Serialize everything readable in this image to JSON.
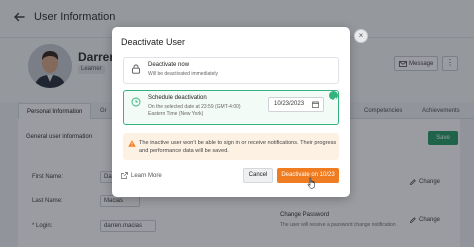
{
  "page": {
    "title": "User Information",
    "user_name": "Darren",
    "role": "Learner",
    "message_label": "Message",
    "more_label": "⋮",
    "tabs": [
      {
        "label": "Personal Information"
      },
      {
        "label": "Gr"
      },
      {
        "label": "Competencies"
      },
      {
        "label": "Achievements"
      }
    ],
    "section_label": "General user information",
    "save_label": "Save",
    "fields": [
      {
        "label": "First Name:",
        "value": "Dar"
      },
      {
        "label": "Last Name:",
        "value": "Macias"
      },
      {
        "label": "* Login:",
        "value": "darren.macias"
      }
    ],
    "change_label": "Change",
    "change_password_title": "Change Password",
    "change_password_desc": "The user will receive a password change notification"
  },
  "modal": {
    "title": "Deactivate User",
    "close_label": "×",
    "option_now": {
      "title": "Deactivate now",
      "desc": "Will be deactivated immediately"
    },
    "option_schedule": {
      "title": "Schedule deactivation",
      "desc_line1": "On the selected date at 23:59 (GMT-4:00)",
      "desc_line2": "Eastern Time (New York)",
      "date_value": "10/23/2023"
    },
    "warning_text": "The inactive user won't be able to sign in or receive notifications. Their progress and performance data will be saved.",
    "learn_more_label": "Learn More",
    "cancel_label": "Cancel",
    "confirm_label": "Deactivate on 10/23"
  },
  "colors": {
    "accent_green": "#35b37e",
    "confirm_orange": "#f07c21",
    "warning_bg": "#fdf1e3"
  }
}
